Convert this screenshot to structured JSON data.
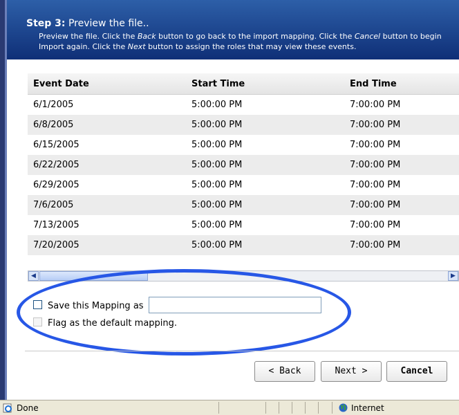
{
  "header": {
    "step_label": "Step 3:",
    "step_title": " Preview the file..",
    "desc": {
      "p1": "Preview the file. Click the ",
      "back_word": "Back",
      "p2": " button to go back to the import mapping. Click the ",
      "cancel_word": "Cancel",
      "p3": " button to begin Import again. Click the ",
      "next_word": "Next",
      "p4": " button to assign the roles that may view these events."
    }
  },
  "table": {
    "columns": [
      "Event Date",
      "Start Time",
      "End Time"
    ],
    "rows": [
      [
        "6/1/2005",
        "5:00:00 PM",
        "7:00:00 PM"
      ],
      [
        "6/8/2005",
        "5:00:00 PM",
        "7:00:00 PM"
      ],
      [
        "6/15/2005",
        "5:00:00 PM",
        "7:00:00 PM"
      ],
      [
        "6/22/2005",
        "5:00:00 PM",
        "7:00:00 PM"
      ],
      [
        "6/29/2005",
        "5:00:00 PM",
        "7:00:00 PM"
      ],
      [
        "7/6/2005",
        "5:00:00 PM",
        "7:00:00 PM"
      ],
      [
        "7/13/2005",
        "5:00:00 PM",
        "7:00:00 PM"
      ],
      [
        "7/20/2005",
        "5:00:00 PM",
        "7:00:00 PM"
      ]
    ]
  },
  "options": {
    "save_mapping_label": "Save this Mapping as",
    "save_mapping_value": "",
    "flag_default_label": "Flag as the default mapping."
  },
  "buttons": {
    "back": "< Back",
    "next": "Next >",
    "cancel": "Cancel"
  },
  "status": {
    "left": "Done",
    "zone": "Internet"
  },
  "colors": {
    "header_top": "#2d5fa8",
    "header_bottom": "#0f2f77",
    "highlight_oval": "#2757e6"
  }
}
